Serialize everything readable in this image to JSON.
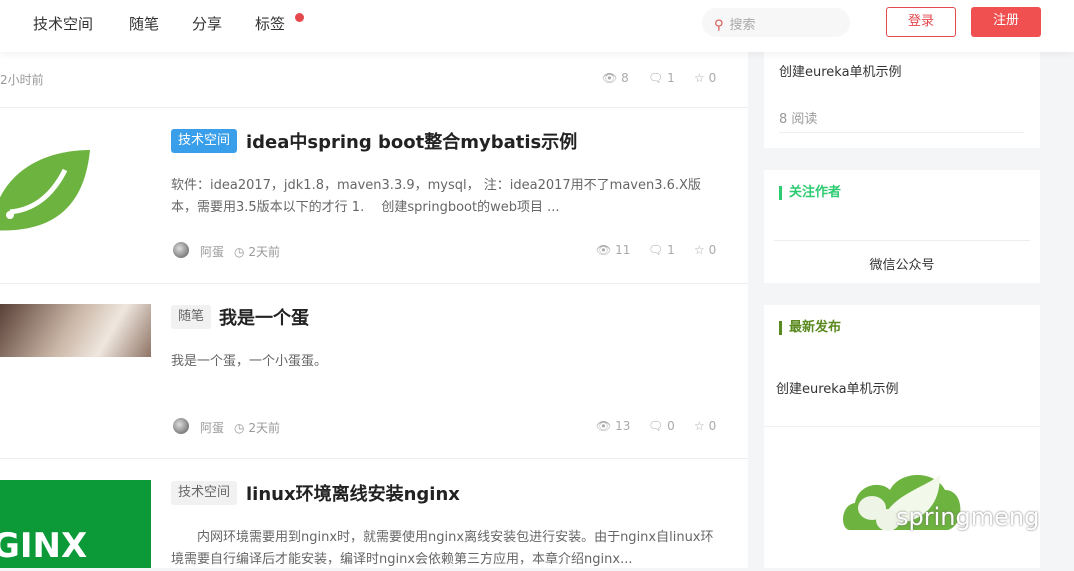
{
  "header": {
    "nav": [
      "技术空间",
      "随笔",
      "分享",
      "标签"
    ],
    "search_placeholder": "搜索",
    "login": "登录",
    "register": "注册"
  },
  "articles": [
    {
      "time": "2小时前",
      "views": "8",
      "comments": "1",
      "likes": "0"
    },
    {
      "tag": "技术空间",
      "title": "idea中spring boot整合mybatis示例",
      "excerpt": "软件：idea2017，jdk1.8，maven3.3.9，mysql， 注：idea2017用不了maven3.6.X版本，需要用3.5版本以下的才行 1.　 创建springboot的web项目 ...",
      "author": "阿蛋",
      "time": "2天前",
      "views": "11",
      "comments": "1",
      "likes": "0"
    },
    {
      "tag": "随笔",
      "title": "我是一个蛋",
      "excerpt": "我是一个蛋，一个小蛋蛋。",
      "author": "阿蛋",
      "time": "2天前",
      "views": "13",
      "comments": "0",
      "likes": "0"
    },
    {
      "tag": "技术空间",
      "title": "linux环境离线安装nginx",
      "excerpt": "　　内网环境需要用到nginx时，就需要使用nginx离线安装包进行安装。由于nginx自linux环境需要自行编译后才能安装，编译时nginx会依赖第三方应用，本章介绍nginx...",
      "thumb_text": "GINX"
    }
  ],
  "sidebar": {
    "popular": {
      "title": "创建eureka单机示例",
      "reads": "8 阅读"
    },
    "follow": {
      "heading": "关注作者",
      "wechat": "微信公众号"
    },
    "latest": {
      "heading": "最新发布",
      "items": [
        "创建eureka单机示例"
      ],
      "logo_text": "springmeng"
    }
  },
  "colors": {
    "accent": "#f0504f",
    "tag_blue": "#3a9fea",
    "spring_green": "#6db33f",
    "follow_bar": "#2ecc71",
    "latest_bar": "#5a8a1f"
  }
}
